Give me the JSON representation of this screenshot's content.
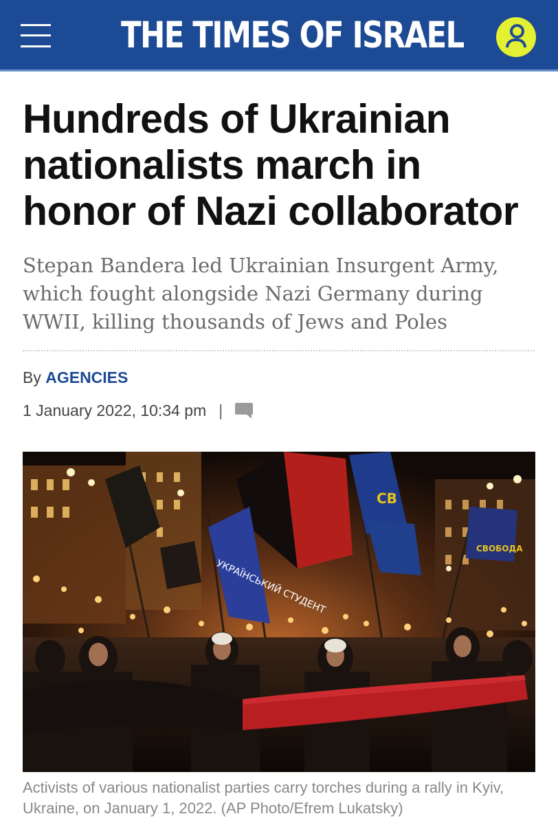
{
  "site": {
    "name": "THE TIMES OF ISRAEL"
  },
  "article": {
    "headline": "Hundreds of Ukrainian nationalists march in honor of Nazi collaborator",
    "subheadline": "Stepan Bandera led Ukrainian Insurgent Army, which fought alongside Nazi Germany during WWII, killing thousands of Jews and Poles",
    "byline_prefix": "By",
    "author": "AGENCIES",
    "date": "1 January 2022, 10:34 pm",
    "separator": "|",
    "photo": {
      "flag_texts": [
        "СВОБОДА",
        "УКРАЇНСЬКИЙ СТУДЕНТ",
        "СВОБОДА"
      ]
    },
    "caption": "Activists of various nationalist parties carry torches during a rally in Kyiv, Ukraine, on January 1, 2022. (AP Photo/Efrem Lukatsky)"
  },
  "icons": {
    "menu": "menu-icon",
    "user": "user-icon",
    "comment": "comment-icon"
  },
  "colors": {
    "brand_blue": "#1d4a94",
    "user_button": "#e4f033",
    "author_link": "#1d4a94"
  }
}
